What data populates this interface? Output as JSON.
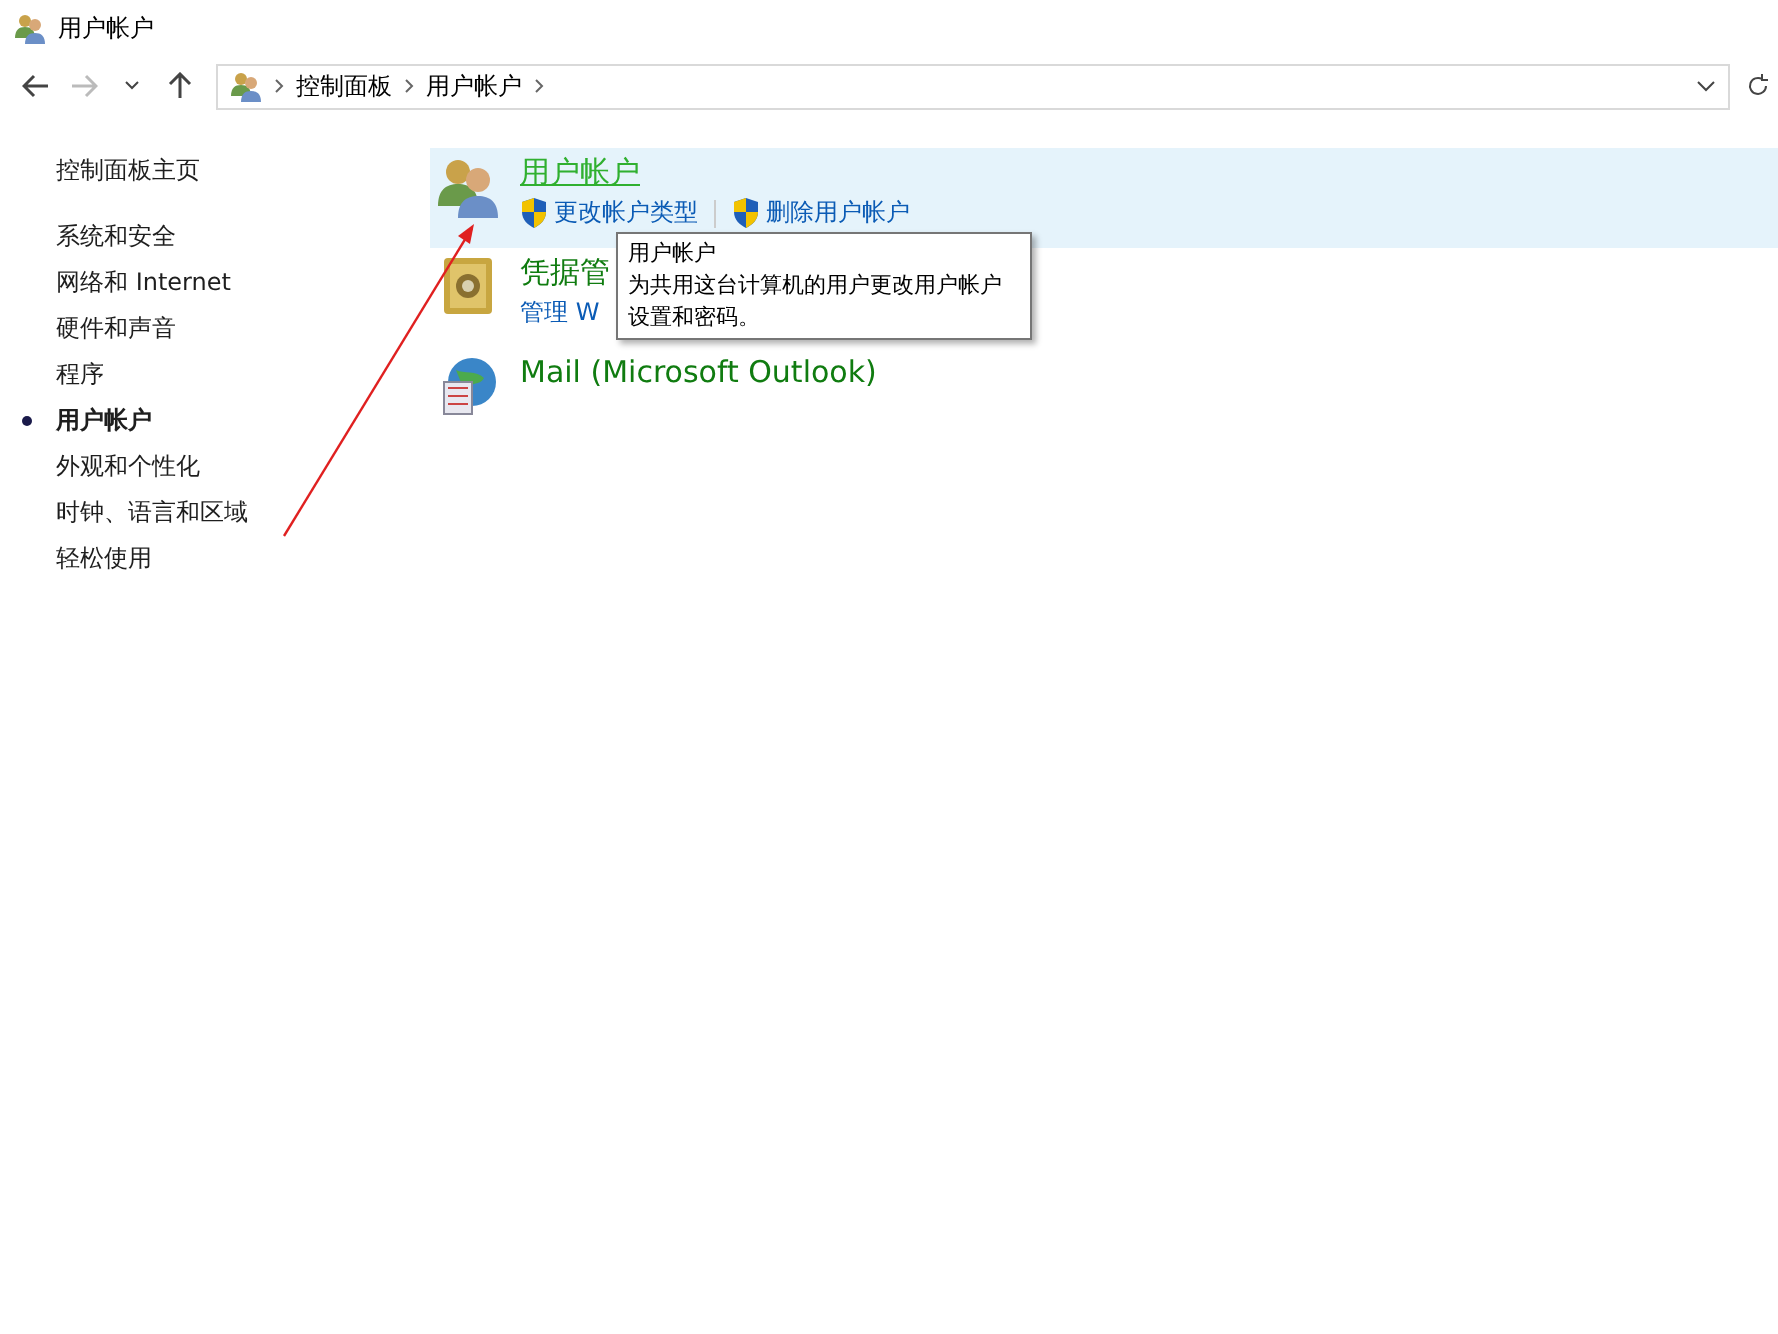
{
  "window": {
    "title": "用户帐户"
  },
  "address_bar": {
    "breadcrumbs": [
      "控制面板",
      "用户帐户"
    ]
  },
  "sidebar": {
    "home": "控制面板主页",
    "items": [
      {
        "label": "系统和安全",
        "selected": false
      },
      {
        "label": "网络和 Internet",
        "selected": false
      },
      {
        "label": "硬件和声音",
        "selected": false
      },
      {
        "label": "程序",
        "selected": false
      },
      {
        "label": "用户帐户",
        "selected": true
      },
      {
        "label": "外观和个性化",
        "selected": false
      },
      {
        "label": "时钟、语言和区域",
        "selected": false
      },
      {
        "label": "轻松使用",
        "selected": false
      }
    ]
  },
  "categories": [
    {
      "kind": "users",
      "title": "用户帐户",
      "hovered": true,
      "links": [
        "更改帐户类型",
        "删除用户帐户"
      ]
    },
    {
      "kind": "vault",
      "title": "凭据管",
      "hovered": false,
      "links": [
        "管理 W"
      ]
    },
    {
      "kind": "mail",
      "title": "Mail (Microsoft Outlook)",
      "hovered": false
    }
  ],
  "tooltip": {
    "title": "用户帐户",
    "text": "为共用这台计算机的用户更改用户帐户设置和密码。"
  }
}
